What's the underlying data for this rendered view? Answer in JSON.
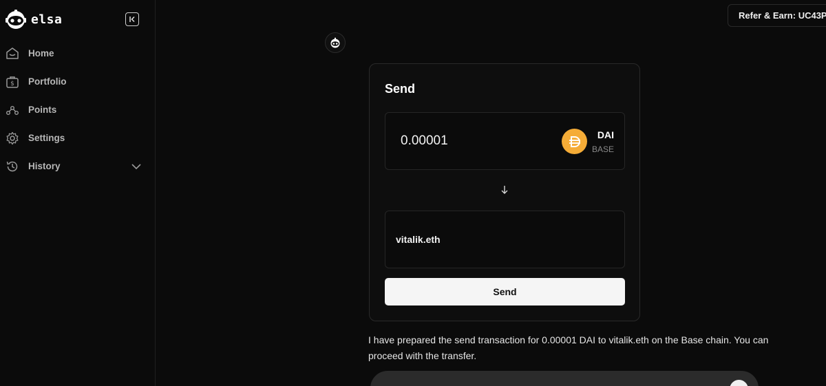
{
  "brand": {
    "name": "elsa",
    "logo_icon": "robot-logo-icon"
  },
  "sidebar": {
    "collapse_icon": "collapse-sidebar-icon",
    "items": [
      {
        "label": "Home",
        "icon": "home-icon"
      },
      {
        "label": "Portfolio",
        "icon": "portfolio-icon"
      },
      {
        "label": "Points",
        "icon": "points-icon"
      },
      {
        "label": "Settings",
        "icon": "gear-icon"
      },
      {
        "label": "History",
        "icon": "history-icon",
        "expand_icon": "chevron-down-icon"
      }
    ]
  },
  "header": {
    "refer_label": "Refer & Earn: UC43P"
  },
  "send_card": {
    "title": "Send",
    "amount": "0.00001",
    "token_symbol": "DAI",
    "token_chain": "BASE",
    "token_color": "#f5ac37",
    "recipient": "vitalik.eth",
    "send_button_label": "Send"
  },
  "message": "I have prepared the send transaction for 0.00001 DAI to vitalik.eth on the Base chain. You can proceed with the transfer.",
  "colors": {
    "background": "#0b0b0b",
    "card_border": "#2a2a2a",
    "button_bg": "#f5f5f5"
  }
}
